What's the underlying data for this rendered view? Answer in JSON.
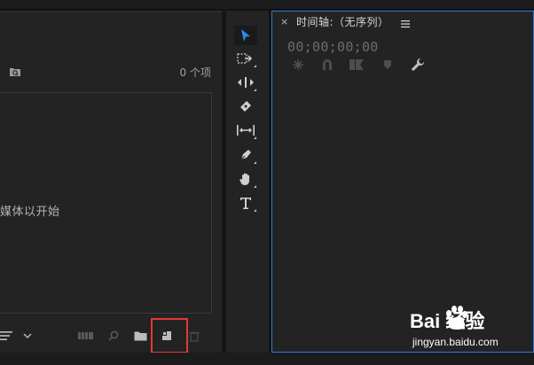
{
  "project_panel": {
    "item_count": "0 个项",
    "empty_message": "媒体以开始"
  },
  "tools": [
    "selection-tool",
    "track-select-forward-tool",
    "ripple-edit-tool",
    "razor-tool",
    "slip-tool",
    "pen-tool",
    "hand-tool",
    "type-tool"
  ],
  "timeline_panel": {
    "close_glyph": "×",
    "title": "时间轴:（无序列）",
    "timecode": "00;00;00;00"
  },
  "watermark": {
    "logo_text": "Bai 经验",
    "url": "jingyan.baidu.com"
  },
  "colors": {
    "panel_bg": "#232323",
    "accent_blue": "#2d7bd6",
    "highlight_red": "#e03a3a"
  }
}
